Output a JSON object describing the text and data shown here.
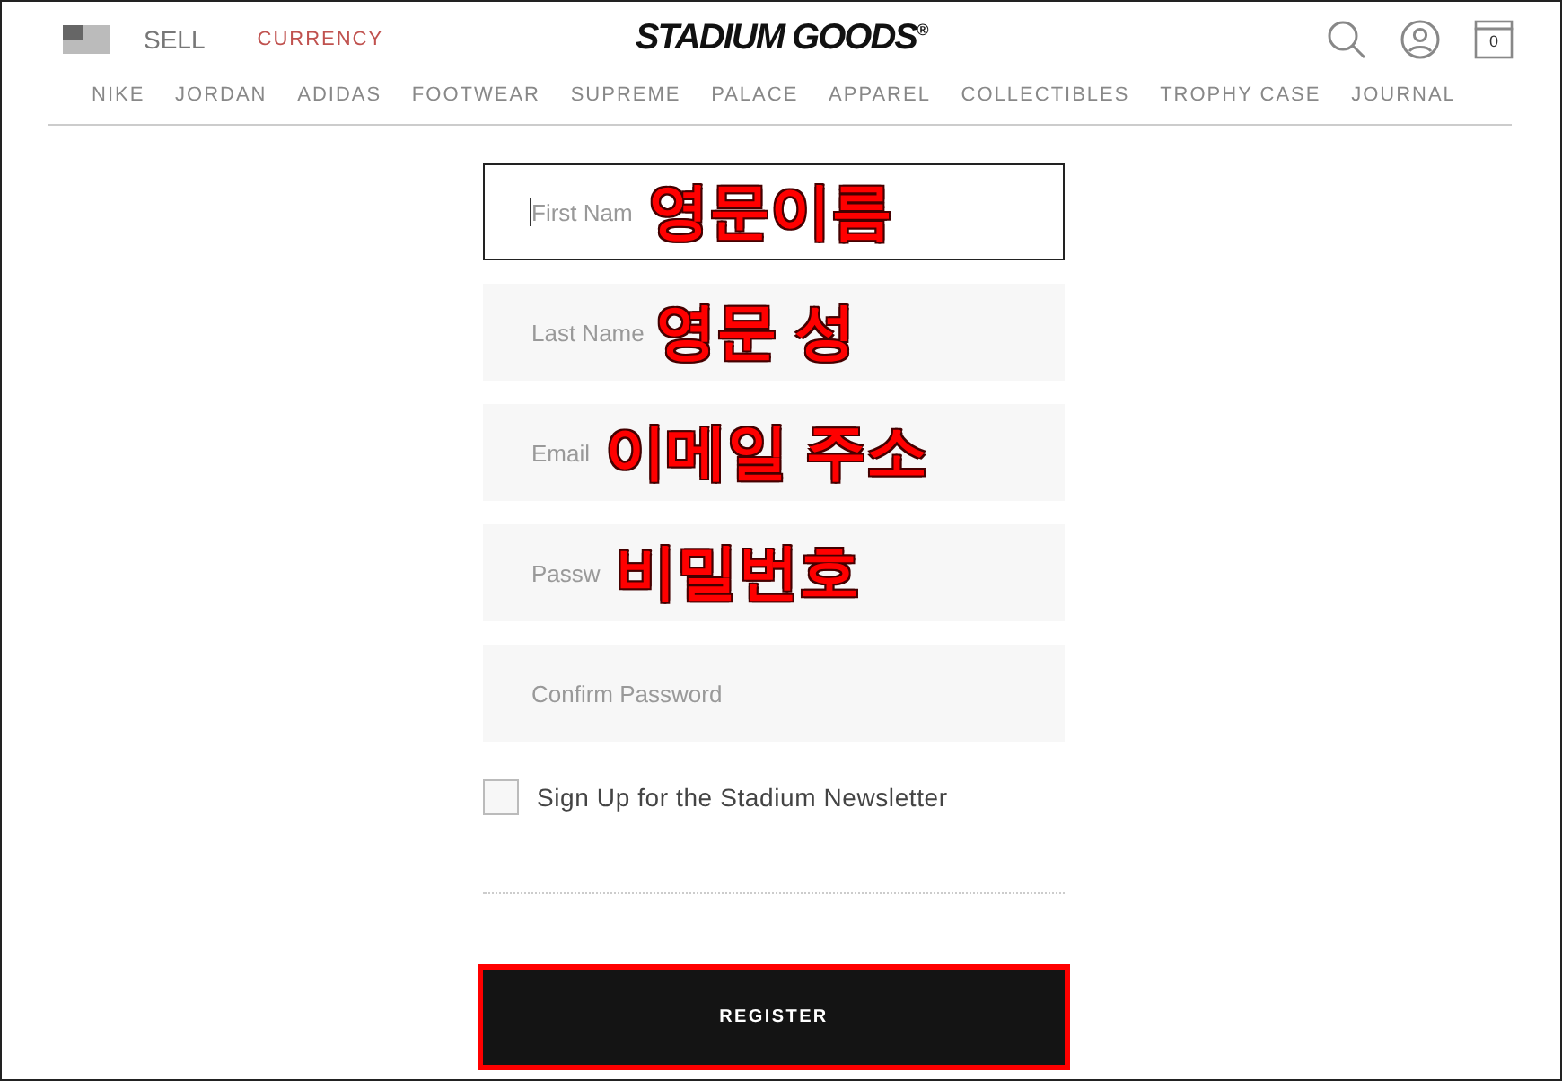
{
  "header": {
    "sell": "SELL",
    "currency": "CURRENCY",
    "logo": "STADIUM GOODS$^{®}$",
    "cart_count": "0"
  },
  "nav": [
    "NIKE",
    "JORDAN",
    "ADIDAS",
    "FOOTWEAR",
    "SUPREME",
    "PALACE",
    "APPAREL",
    "COLLECTIBLES",
    "TROPHY CASE",
    "JOURNAL"
  ],
  "fields": [
    {
      "placeholder": "First Nam",
      "focused": true,
      "annotation": "영문이름"
    },
    {
      "placeholder": "Last Name",
      "focused": false,
      "annotation": "영문 성"
    },
    {
      "placeholder": "Email",
      "focused": false,
      "annotation": "이메일 주소"
    },
    {
      "placeholder": "Passw",
      "focused": false,
      "annotation": "비밀번호"
    },
    {
      "placeholder": "Confirm Password",
      "focused": false
    }
  ],
  "newsletter": {
    "label": "Sign Up for the Stadium Newsletter",
    "checked": false
  },
  "register": {
    "label": "REGISTER",
    "highlighted": true
  }
}
